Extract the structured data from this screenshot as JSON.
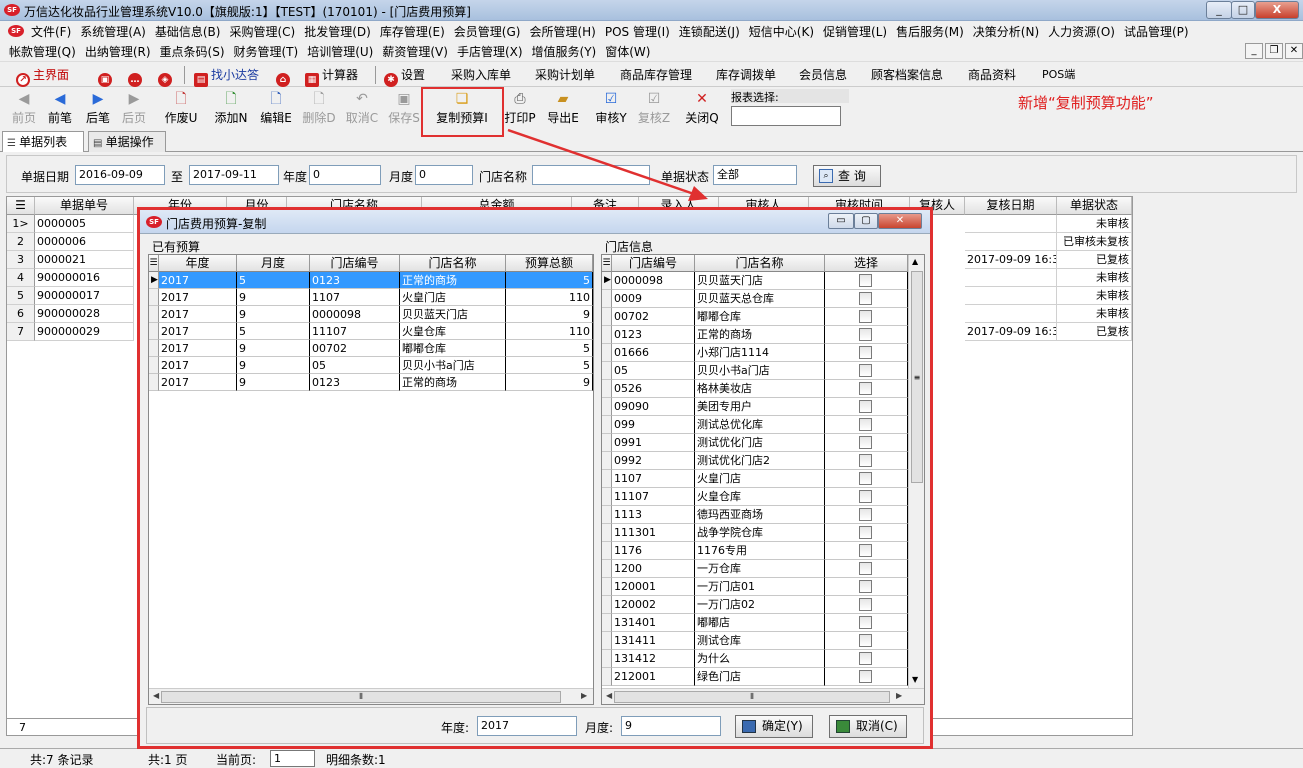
{
  "window": {
    "title": "万信达化妆品行业管理系统V10.0【旗舰版:1】【TEST】(170101) - [门店费用预算]",
    "logo": "logo-icon",
    "min": "_",
    "max": "□",
    "close": "X"
  },
  "menu": {
    "row1": [
      "文件(F)",
      "系统管理(A)",
      "基础信息(B)",
      "采购管理(C)",
      "批发管理(D)",
      "库存管理(E)",
      "会员管理(G)",
      "会所管理(H)",
      "POS 管理(I)",
      "连锁配送(J)",
      "短信中心(K)",
      "促销管理(L)",
      "售后服务(M)",
      "决策分析(N)",
      "人力资源(O)",
      "试品管理(P)"
    ],
    "row2": [
      "帐款管理(Q)",
      "出纳管理(R)",
      "重点条码(S)",
      "财务管理(T)",
      "培训管理(U)",
      "薪资管理(V)",
      "手店管理(X)",
      "增值服务(Y)",
      "窗体(W)"
    ]
  },
  "quickbar": [
    "主界面",
    "找小达答",
    "计算器",
    "设置",
    "采购入库单",
    "采购计划单",
    "商品库存管理",
    "库存调拨单",
    "会员信息",
    "顾客档案信息",
    "商品资料",
    "POS端"
  ],
  "toolbar": {
    "buttons": [
      "前页",
      "前笔",
      "后笔",
      "后页",
      "作废U",
      "添加N",
      "编辑E",
      "删除D",
      "取消C",
      "保存S",
      "复制预算I",
      "打印P",
      "导出E",
      "审核Y",
      "复核Z",
      "关闭Q"
    ],
    "report_label": "报表选择:",
    "annotation": "新增“复制预算功能”"
  },
  "tabs": [
    "单据列表",
    "单据操作"
  ],
  "filter": {
    "date_label": "单据日期",
    "date_from": "2016-09-09",
    "to_label": "至",
    "date_to": "2017-09-11",
    "year_label": "年度",
    "year": "0",
    "month_label": "月度",
    "month": "0",
    "store_label": "门店名称",
    "store": "",
    "status_label": "单据状态",
    "status": "全部",
    "query": "查 询"
  },
  "grid": {
    "headers": [
      "单据单号",
      "年份",
      "月份",
      "门店名称",
      "总金额",
      "备注",
      "录入人",
      "审核人",
      "审核时间",
      "复核人",
      "复核日期",
      "单据状态"
    ],
    "rows": [
      {
        "n": "1",
        "id": "0000005",
        "review_date": "",
        "status": "未审核",
        "mark": true
      },
      {
        "n": "2",
        "id": "0000006",
        "review_date": "",
        "status": "已审核未复核"
      },
      {
        "n": "3",
        "id": "0000021",
        "review_date": "2017-09-09 16:3",
        "status": "已复核"
      },
      {
        "n": "4",
        "id": "900000016",
        "review_date": "",
        "status": "未审核"
      },
      {
        "n": "5",
        "id": "900000017",
        "review_date": "",
        "status": "未审核"
      },
      {
        "n": "6",
        "id": "900000028",
        "review_date": "",
        "status": "未审核"
      },
      {
        "n": "7",
        "id": "900000029",
        "review_date": "2017-09-09 16:3",
        "status": "已复核"
      }
    ],
    "footer_count": "7"
  },
  "status": {
    "total": "共:7 条记录",
    "pages": "共:1 页",
    "current_label": "当前页:",
    "current": "1",
    "details": "明细条数:1"
  },
  "dialog": {
    "title": "门店费用预算-复制",
    "left": {
      "group": "已有预算",
      "headers": [
        "年度",
        "月度",
        "门店编号",
        "门店名称",
        "预算总额"
      ],
      "rows": [
        [
          "2017",
          "5",
          "0123",
          "正常的商场",
          "5"
        ],
        [
          "2017",
          "9",
          "1107",
          "火皇门店",
          "110"
        ],
        [
          "2017",
          "9",
          "0000098",
          "贝贝蓝天门店",
          "9"
        ],
        [
          "2017",
          "5",
          "11107",
          "火皇仓库",
          "110"
        ],
        [
          "2017",
          "9",
          "00702",
          "嘟嘟仓库",
          "5"
        ],
        [
          "2017",
          "9",
          "05",
          "贝贝小书a门店",
          "5"
        ],
        [
          "2017",
          "9",
          "0123",
          "正常的商场",
          "9"
        ]
      ]
    },
    "right": {
      "group": "门店信息",
      "headers": [
        "门店编号",
        "门店名称",
        "选择"
      ],
      "rows": [
        [
          "0000098",
          "贝贝蓝天门店"
        ],
        [
          "0009",
          "贝贝蓝天总仓库"
        ],
        [
          "00702",
          "嘟嘟仓库"
        ],
        [
          "0123",
          "正常的商场"
        ],
        [
          "01666",
          "小郑门店1114"
        ],
        [
          "05",
          "贝贝小书a门店"
        ],
        [
          "0526",
          "格林美妆店"
        ],
        [
          "09090",
          "美团专用户"
        ],
        [
          "099",
          "测试总优化库"
        ],
        [
          "0991",
          "测试优化门店"
        ],
        [
          "0992",
          "测试优化门店2"
        ],
        [
          "1107",
          "火皇门店"
        ],
        [
          "11107",
          "火皇仓库"
        ],
        [
          "1113",
          "德玛西亚商场"
        ],
        [
          "111301",
          "战争学院仓库"
        ],
        [
          "1176",
          "1176专用"
        ],
        [
          "1200",
          "一万仓库"
        ],
        [
          "120001",
          "一万门店01"
        ],
        [
          "120002",
          "一万门店02"
        ],
        [
          "131401",
          "嘟嘟店"
        ],
        [
          "131411",
          "测试仓库"
        ],
        [
          "131412",
          "为什么"
        ],
        [
          "212001",
          "绿色门店"
        ]
      ]
    },
    "bottom": {
      "year_label": "年度:",
      "year": "2017",
      "month_label": "月度:",
      "month": "9",
      "ok": "确定(Y)",
      "cancel": "取消(C)"
    }
  }
}
